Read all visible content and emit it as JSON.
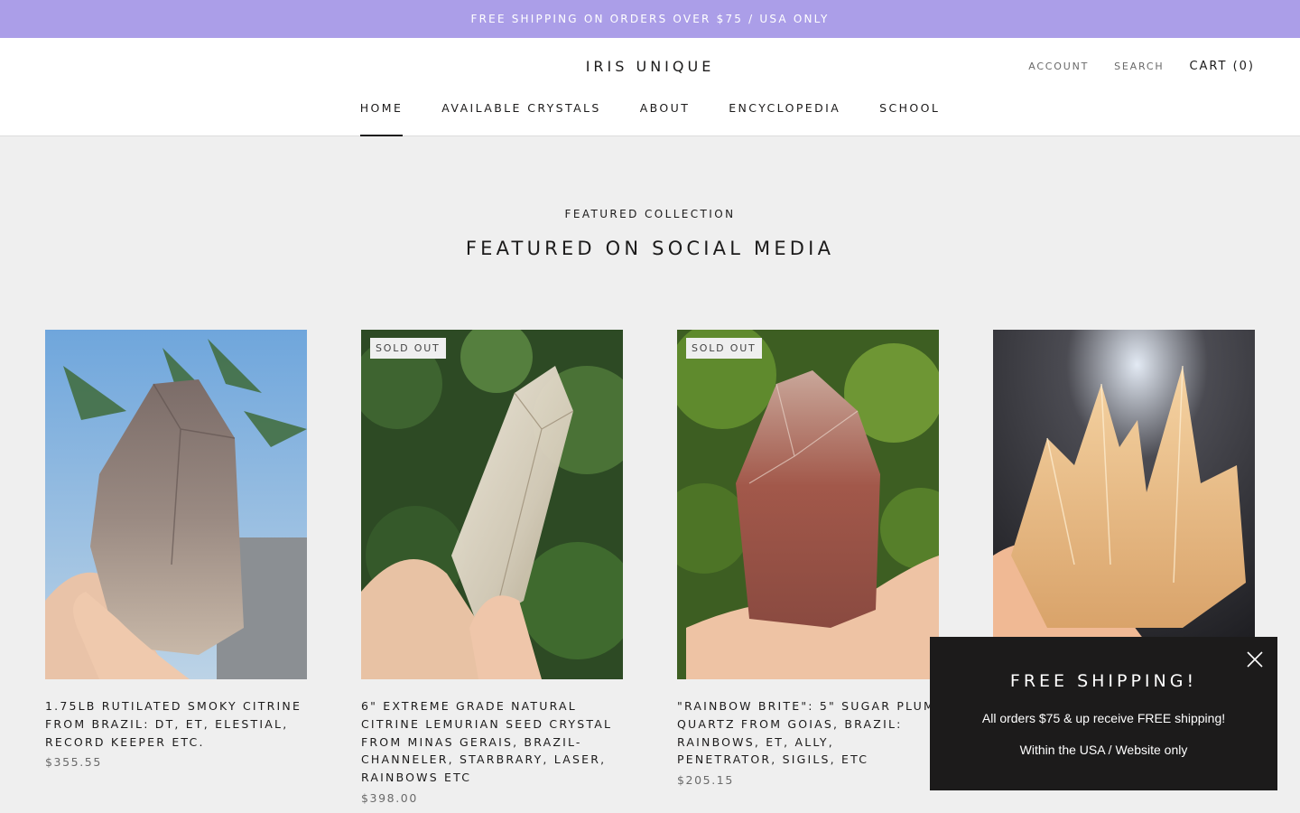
{
  "announcement": "FREE SHIPPING ON ORDERS OVER $75 / USA ONLY",
  "header": {
    "logo": "IRIS UNIQUE",
    "account_label": "ACCOUNT",
    "search_label": "SEARCH",
    "cart_label": "CART (0)"
  },
  "nav": {
    "items": [
      {
        "label": "HOME",
        "active": true
      },
      {
        "label": "AVAILABLE CRYSTALS",
        "active": false
      },
      {
        "label": "ABOUT",
        "active": false
      },
      {
        "label": "ENCYCLOPEDIA",
        "active": false
      },
      {
        "label": "SCHOOL",
        "active": false
      }
    ]
  },
  "section": {
    "eyebrow": "FEATURED COLLECTION",
    "title": "FEATURED ON SOCIAL MEDIA"
  },
  "products": [
    {
      "title": "1.75LB RUTILATED SMOKY CITRINE FROM BRAZIL: DT, ET, ELESTIAL, RECORD KEEPER ETC.",
      "price": "$355.55",
      "badge": ""
    },
    {
      "title": "6\" EXTREME GRADE NATURAL CITRINE LEMURIAN SEED CRYSTAL FROM MINAS GERAIS, BRAZIL- CHANNELER, STARBRARY, LASER, RAINBOWS ETC",
      "price": "$398.00",
      "badge": "SOLD OUT"
    },
    {
      "title": "\"RAINBOW BRITE\": 5\" SUGAR PLUM QUARTZ FROM GOIAS, BRAZIL: RAINBOWS, ET, ALLY, PENETRATOR, SIGILS, ETC",
      "price": "$205.15",
      "badge": "SOLD OUT"
    },
    {
      "title": "",
      "price": "",
      "badge": ""
    }
  ],
  "popup": {
    "heading": "FREE SHIPPING!",
    "line1": "All orders $75 & up receive FREE shipping!",
    "line2": "Within the USA / Website only"
  },
  "colors": {
    "announcement_bg": "#ab9ee8",
    "page_bg": "#efefef",
    "popup_bg": "#1c1b1b",
    "text": "#1c1b1b"
  }
}
